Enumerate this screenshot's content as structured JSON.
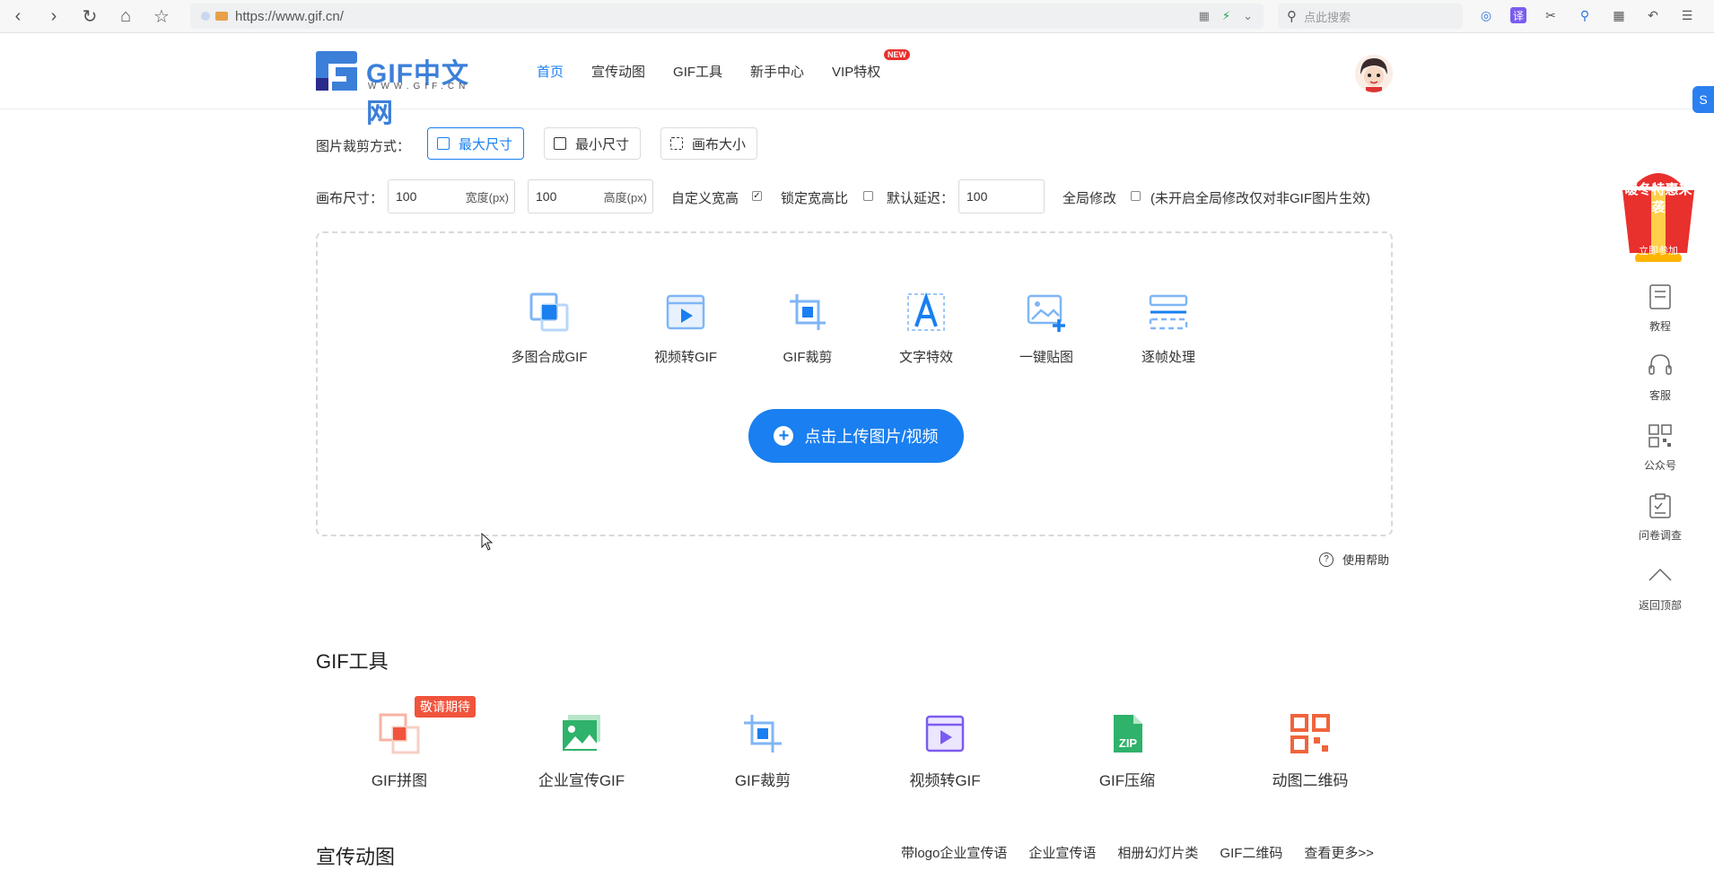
{
  "browser": {
    "url": "https://www.gif.cn/",
    "search_placeholder": "点此搜索"
  },
  "header": {
    "logo_text": "GIF中文网",
    "logo_sub": "WWW.GIF.CN",
    "nav": [
      "首页",
      "宣传动图",
      "GIF工具",
      "新手中心",
      "VIP特权"
    ],
    "new_badge": "NEW"
  },
  "crop": {
    "label": "图片裁剪方式：",
    "options": [
      "最大尺寸",
      "最小尺寸",
      "画布大小"
    ],
    "selected": "最大尺寸"
  },
  "canvas": {
    "label": "画布尺寸：",
    "width_value": "100",
    "width_unit": "宽度(px)",
    "height_value": "100",
    "height_unit": "高度(px)",
    "custom_label": "自定义宽高",
    "custom_checked": true,
    "lock_label": "锁定宽高比",
    "lock_checked": false,
    "delay_label": "默认延迟：",
    "delay_value": "100",
    "global_label": "全局修改",
    "global_checked": false,
    "global_note": "(未开启全局修改仅对非GIF图片生效)"
  },
  "upload": {
    "tools": [
      "多图合成GIF",
      "视频转GIF",
      "GIF裁剪",
      "文字特效",
      "一键贴图",
      "逐帧处理"
    ],
    "button": "点击上传图片/视频",
    "help": "使用帮助"
  },
  "gif_tools": {
    "title": "GIF工具",
    "soon_badge": "敬请期待",
    "items": [
      "GIF拼图",
      "企业宣传GIF",
      "GIF裁剪",
      "视频转GIF",
      "GIF压缩",
      "动图二维码"
    ],
    "zip_text": "ZIP"
  },
  "promo_section": {
    "title": "宣传动图",
    "links": [
      "带logo企业宣传语",
      "企业宣传语",
      "相册幻灯片类",
      "GIF二维码",
      "查看更多>>"
    ]
  },
  "sidebar": {
    "promo_title": "暖冬特惠来袭",
    "promo_button": "立即参加",
    "items": [
      "教程",
      "客服",
      "公众号",
      "问卷调查",
      "返回顶部"
    ]
  },
  "colors": {
    "accent": "#1a7ff0",
    "badge_red": "#e8302d",
    "soon_orange": "#f0543c",
    "zip_green": "#2fb26a",
    "qr_orange": "#f0643c"
  }
}
